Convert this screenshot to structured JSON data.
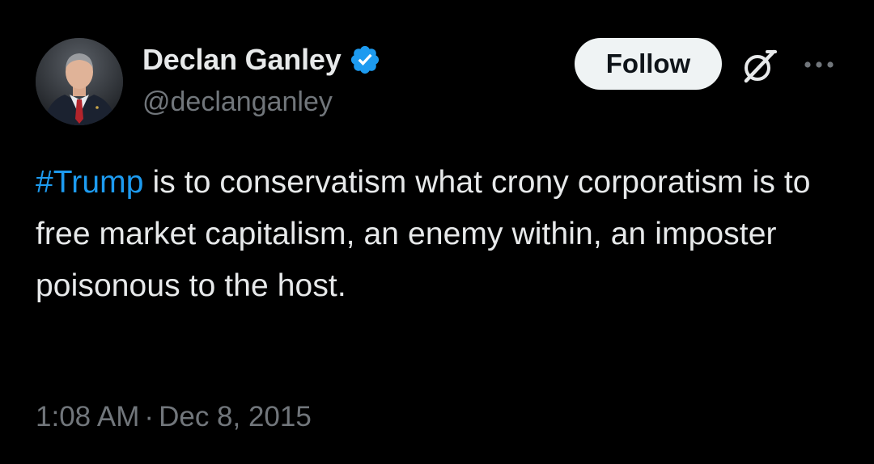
{
  "author": {
    "display_name": "Declan Ganley",
    "handle": "@declanganley",
    "verified": true,
    "verified_color": "#1d9bf0"
  },
  "actions": {
    "follow_label": "Follow",
    "grok_icon": "grok-icon",
    "more_icon": "more-icon"
  },
  "tweet": {
    "hashtag": "#Trump",
    "text": " is to conservatism what crony corporatism is to free market capitalism, an enemy within, an imposter poisonous to the host.",
    "time": "1:08 AM",
    "separator": "·",
    "date": "Dec 8, 2015"
  },
  "colors": {
    "background": "#000000",
    "primary_text": "#e7e9ea",
    "secondary_text": "#71767b",
    "link": "#1d9bf0",
    "follow_bg": "#eff3f4"
  }
}
